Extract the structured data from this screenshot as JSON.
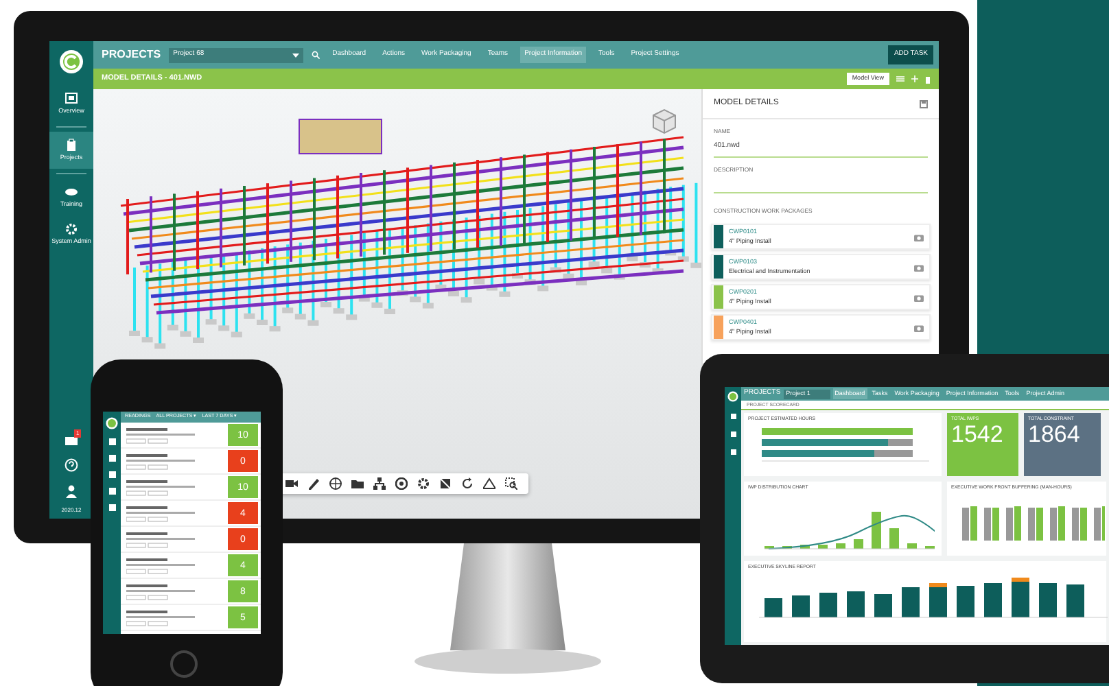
{
  "monitor": {
    "sidebar": {
      "items": [
        {
          "label": "Overview",
          "selected": false
        },
        {
          "label": "Projects",
          "selected": true
        },
        {
          "label": "Training",
          "selected": false
        },
        {
          "label": "System Admin",
          "selected": false
        }
      ],
      "badge": "1",
      "version": "2020.12"
    },
    "topbar": {
      "title": "PROJECTS",
      "project_select": "Project 68",
      "nav": [
        {
          "label": "Dashboard",
          "selected": false
        },
        {
          "label": "Actions",
          "selected": false
        },
        {
          "label": "Work Packaging",
          "selected": false
        },
        {
          "label": "Teams",
          "selected": false
        },
        {
          "label": "Project Information",
          "selected": true
        },
        {
          "label": "Tools",
          "selected": false
        },
        {
          "label": "Project Settings",
          "selected": false
        }
      ],
      "add_task": "ADD TASK"
    },
    "subheader": {
      "title": "MODEL DETAILS - 401.NWD",
      "model_view": "Model View"
    },
    "details": {
      "title": "MODEL DETAILS",
      "name_label": "NAME",
      "name_value": "401.nwd",
      "description_label": "DESCRIPTION",
      "section": "CONSTRUCTION WORK PACKAGES",
      "packages": [
        {
          "code": "CWP0101",
          "name": "4\" Piping Install",
          "color": "#0e5f5c"
        },
        {
          "code": "CWP0103",
          "name": "Electrical and Instrumentation",
          "color": "#0e5f5c"
        },
        {
          "code": "CWP0201",
          "name": "4\" Piping Install",
          "color": "#8bc34a"
        },
        {
          "code": "CWP0401",
          "name": "4\" Piping Install",
          "color": "#f7a25c"
        }
      ]
    }
  },
  "phone": {
    "title": "READINGS",
    "filters": [
      "ALL PROJECTS ▾",
      "LAST 7 DAYS ▾"
    ],
    "readings": [
      {
        "value": "10",
        "color": "#7cc242"
      },
      {
        "value": "0",
        "color": "#e8401c"
      },
      {
        "value": "10",
        "color": "#7cc242"
      },
      {
        "value": "4",
        "color": "#e8401c"
      },
      {
        "value": "0",
        "color": "#e8401c"
      },
      {
        "value": "4",
        "color": "#7cc242"
      },
      {
        "value": "8",
        "color": "#7cc242"
      },
      {
        "value": "5",
        "color": "#7cc242"
      }
    ]
  },
  "tablet": {
    "topbar": {
      "title": "PROJECTS",
      "project_select": "Project 1",
      "nav": [
        {
          "label": "Dashboard",
          "selected": true
        },
        {
          "label": "Tasks",
          "selected": false
        },
        {
          "label": "Work Packaging",
          "selected": false
        },
        {
          "label": "Project Information",
          "selected": false
        },
        {
          "label": "Tools",
          "selected": false
        },
        {
          "label": "Project Admin",
          "selected": false
        }
      ]
    },
    "subheader": "PROJECT SCORECARD",
    "estimated_title": "PROJECT ESTIMATED HOURS",
    "stats": [
      {
        "title": "TOTAL IWPS",
        "value": "1542",
        "color": "#7cc242"
      },
      {
        "title": "TOTAL CONSTRAINT",
        "value": "1864",
        "color": "#5c7183"
      }
    ],
    "distribution_title": "IWP DISTRIBUTION CHART",
    "buffering_title": "EXECUTIVE WORK FRONT BUFFERING (MAN-HOURS)",
    "skyline_title": "EXECUTIVE SKYLINE REPORT"
  }
}
